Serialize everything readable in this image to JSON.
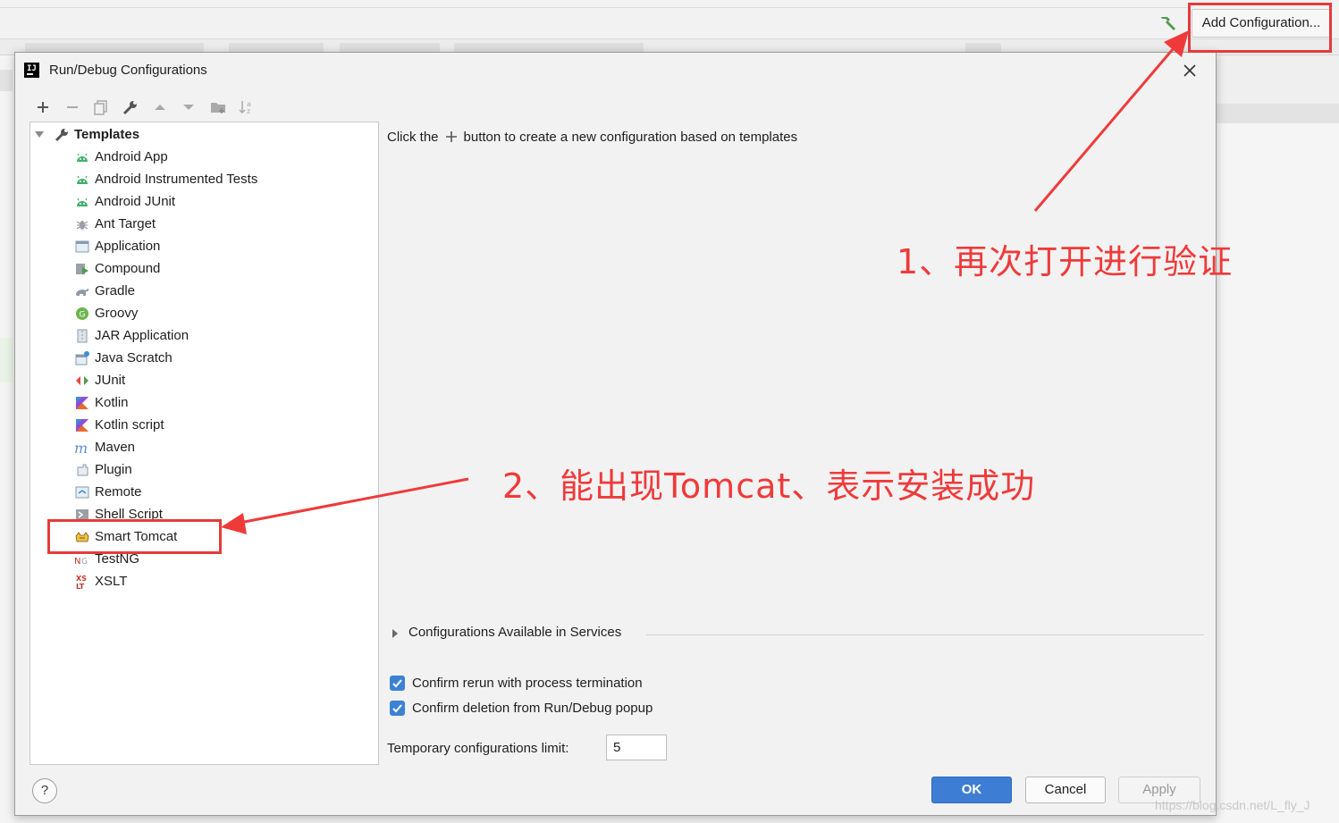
{
  "ide": {
    "add_configuration_label": "Add Configuration..."
  },
  "dialog": {
    "title": "Run/Debug Configurations",
    "tree": {
      "root_label": "Templates",
      "items": [
        {
          "label": "Android App",
          "icon": "android-icon"
        },
        {
          "label": "Android Instrumented Tests",
          "icon": "android-icon"
        },
        {
          "label": "Android JUnit",
          "icon": "android-icon"
        },
        {
          "label": "Ant Target",
          "icon": "ant-icon"
        },
        {
          "label": "Application",
          "icon": "application-icon"
        },
        {
          "label": "Compound",
          "icon": "compound-icon"
        },
        {
          "label": "Gradle",
          "icon": "gradle-icon"
        },
        {
          "label": "Groovy",
          "icon": "groovy-icon"
        },
        {
          "label": "JAR Application",
          "icon": "jar-icon"
        },
        {
          "label": "Java Scratch",
          "icon": "java-scratch-icon"
        },
        {
          "label": "JUnit",
          "icon": "junit-icon"
        },
        {
          "label": "Kotlin",
          "icon": "kotlin-icon"
        },
        {
          "label": "Kotlin script",
          "icon": "kotlin-icon"
        },
        {
          "label": "Maven",
          "icon": "maven-icon"
        },
        {
          "label": "Plugin",
          "icon": "plugin-icon"
        },
        {
          "label": "Remote",
          "icon": "remote-icon"
        },
        {
          "label": "Shell Script",
          "icon": "shell-script-icon"
        },
        {
          "label": "Smart Tomcat",
          "icon": "tomcat-icon"
        },
        {
          "label": "TestNG",
          "icon": "testng-icon"
        },
        {
          "label": "XSLT",
          "icon": "xslt-icon"
        }
      ]
    },
    "hint_before": "Click the",
    "hint_after": "button to create a new configuration based on templates",
    "services_label": "Configurations Available in Services",
    "confirm_rerun_label": "Confirm rerun with process termination",
    "confirm_rerun_checked": true,
    "confirm_deletion_label": "Confirm deletion from Run/Debug popup",
    "confirm_deletion_checked": true,
    "temp_limit_label": "Temporary configurations limit:",
    "temp_limit_value": "5",
    "help_label": "?",
    "ok_label": "OK",
    "cancel_label": "Cancel",
    "apply_label": "Apply"
  },
  "annotations": {
    "note1": "1、再次打开进行验证",
    "note2": "2、能出现Tomcat、表示安装成功",
    "color": "#e53b3b"
  },
  "watermark": "https://blog.csdn.net/L_fly_J"
}
